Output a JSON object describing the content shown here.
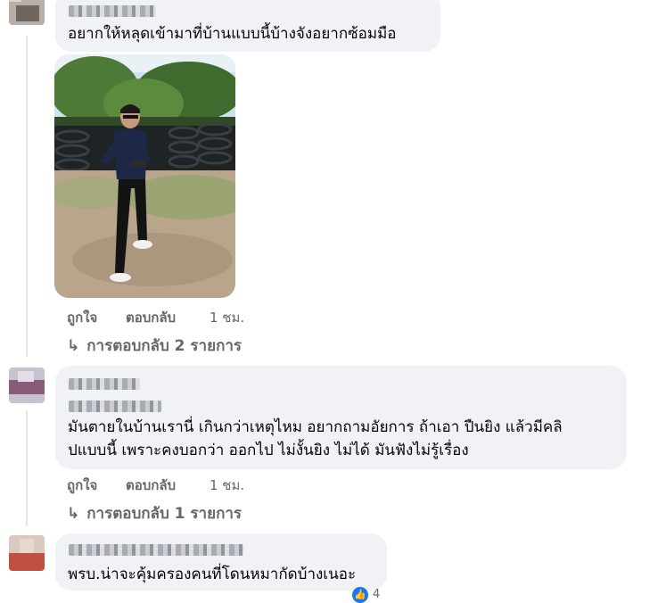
{
  "comments": [
    {
      "text_lines": [
        "อยากให้หลุดเข้ามาที่บ้านแบบนี้บ้างจังอยากซ้อมมือ"
      ],
      "actions": {
        "like": "ถูกใจ",
        "reply": "ตอบกลับ",
        "time": "1 ชม."
      },
      "replies_link": "การตอบกลับ 2 รายการ"
    },
    {
      "text_lines": [
        "มันตายในบ้านเรานี่ เกินกว่าเหตุไหม อยากถามอัยการ ถ้าเอา ปืนยิง แล้วมีคลิ",
        "ปแบบนี้ เพราะคงบอกว่า ออกไป ไม่งั้นยิง ไม่ได้ มันฟังไม่รู้เรื่อง"
      ],
      "actions": {
        "like": "ถูกใจ",
        "reply": "ตอบกลับ",
        "time": "1 ชม."
      },
      "replies_link": "การตอบกลับ 1 รายการ"
    },
    {
      "text_lines": [
        "พรบ.น่าจะคุ้มครองคนที่โดนหมากัดบ้างเนอะ"
      ],
      "reaction_count": "4"
    }
  ],
  "icons": {
    "reply_arrow": "reply-arrow-icon",
    "reaction": "like-reaction-icon"
  },
  "colors": {
    "bubble": "#f0f2f5",
    "secondary_text": "#65676b",
    "accent": "#1877f2"
  }
}
